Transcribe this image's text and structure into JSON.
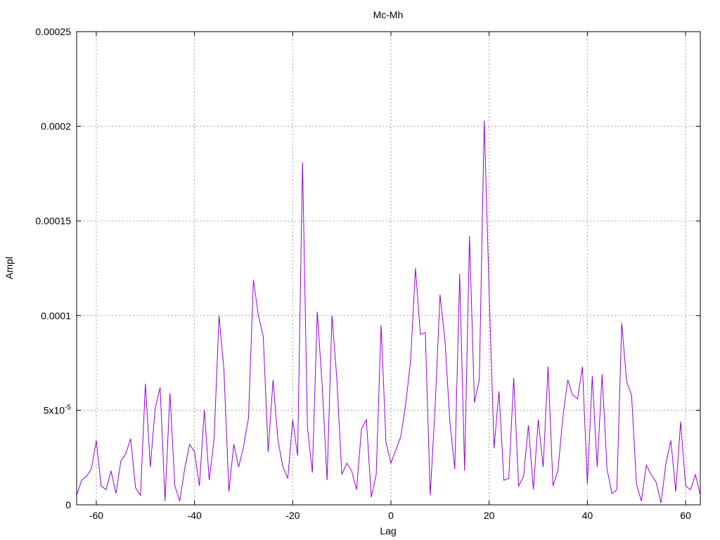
{
  "chart_data": {
    "type": "line",
    "title": "Mc-Mh",
    "xlabel": "Lag",
    "ylabel": "Ampl",
    "xlim": [
      -64,
      63
    ],
    "ylim": [
      0,
      0.00025
    ],
    "grid": true,
    "x_ticks": [
      {
        "value": -60,
        "label": "-60"
      },
      {
        "value": -40,
        "label": "-40"
      },
      {
        "value": -20,
        "label": "-20"
      },
      {
        "value": 0,
        "label": "0"
      },
      {
        "value": 20,
        "label": "20"
      },
      {
        "value": 40,
        "label": "40"
      },
      {
        "value": 60,
        "label": "60"
      }
    ],
    "y_ticks": [
      {
        "value": 0,
        "label": "0"
      },
      {
        "value": 5e-05,
        "label": "5x10",
        "exp": "-5"
      },
      {
        "value": 0.0001,
        "label": "0.0001"
      },
      {
        "value": 0.00015,
        "label": "0.00015"
      },
      {
        "value": 0.0002,
        "label": "0.0002"
      },
      {
        "value": 0.00025,
        "label": "0.00025"
      }
    ],
    "series": [
      {
        "color": "#9400d3",
        "x": [
          -64,
          -63,
          -62,
          -61,
          -60,
          -59,
          -58,
          -57,
          -56,
          -55,
          -54,
          -53,
          -52,
          -51,
          -50,
          -49,
          -48,
          -47,
          -46,
          -45,
          -44,
          -43,
          -42,
          -41,
          -40,
          -39,
          -38,
          -37,
          -36,
          -35,
          -34,
          -33,
          -32,
          -31,
          -30,
          -29,
          -28,
          -27,
          -26,
          -25,
          -24,
          -23,
          -22,
          -21,
          -20,
          -19,
          -18,
          -17,
          -16,
          -15,
          -14,
          -13,
          -12,
          -11,
          -10,
          -9,
          -8,
          -7,
          -6,
          -5,
          -4,
          -3,
          -2,
          -1,
          0,
          1,
          2,
          3,
          4,
          5,
          6,
          7,
          8,
          9,
          10,
          11,
          12,
          13,
          14,
          15,
          16,
          17,
          18,
          19,
          20,
          21,
          22,
          23,
          24,
          25,
          26,
          27,
          28,
          29,
          30,
          31,
          32,
          33,
          34,
          35,
          36,
          37,
          38,
          39,
          40,
          41,
          42,
          43,
          44,
          45,
          46,
          47,
          48,
          49,
          50,
          51,
          52,
          53,
          54,
          55,
          56,
          57,
          58,
          59,
          60,
          61,
          62,
          63
        ],
        "y": [
          5e-06,
          1.3e-05,
          1.5e-05,
          1.9e-05,
          3.4e-05,
          1e-05,
          8e-06,
          1.8e-05,
          6e-06,
          2.3e-05,
          2.7e-05,
          3.5e-05,
          9e-06,
          5e-06,
          6.4e-05,
          2e-05,
          5.1e-05,
          6.2e-05,
          2e-06,
          5.9e-05,
          1e-05,
          2e-06,
          1.9e-05,
          3.2e-05,
          2.8e-05,
          1e-05,
          5e-05,
          1.3e-05,
          3.5e-05,
          0.0001,
          7.1e-05,
          7e-06,
          3.2e-05,
          2e-05,
          3.1e-05,
          4.6e-05,
          0.000119,
          0.0001,
          8.9e-05,
          2.8e-05,
          6.6e-05,
          3.4e-05,
          2e-05,
          1.4e-05,
          4.5e-05,
          2.6e-05,
          0.000181,
          4.1e-05,
          1.7e-05,
          0.000102,
          6.3e-05,
          1.3e-05,
          0.0001,
          6.6e-05,
          1.6e-05,
          2.2e-05,
          1.8e-05,
          8e-06,
          4e-05,
          4.5e-05,
          4e-06,
          1.6e-05,
          9.5e-05,
          3.3e-05,
          2.2e-05,
          2.9e-05,
          3.6e-05,
          5.3e-05,
          7.6e-05,
          0.000125,
          9e-05,
          9.1e-05,
          5e-06,
          5.2e-05,
          0.000111,
          8.7e-05,
          4.4e-05,
          1.9e-05,
          0.000122,
          1.8e-05,
          0.000142,
          5.4e-05,
          6.6e-05,
          0.000203,
          0.000112,
          3e-05,
          6e-05,
          1.3e-05,
          1.4e-05,
          6.7e-05,
          1e-05,
          1.5e-05,
          4.2e-05,
          8e-06,
          4.5e-05,
          2e-05,
          7.3e-05,
          1e-05,
          1.8e-05,
          4.6e-05,
          6.6e-05,
          5.8e-05,
          5.6e-05,
          7.3e-05,
          1.1e-05,
          6.8e-05,
          2e-05,
          6.9e-05,
          1.9e-05,
          6e-06,
          8e-06,
          9.6e-05,
          6.5e-05,
          5.8e-05,
          1.1e-05,
          2e-06,
          2.1e-05,
          1.6e-05,
          1.2e-05,
          1e-06,
          2.2e-05,
          3.4e-05,
          7e-06,
          4.4e-05,
          1e-05,
          8e-06,
          1.6e-05,
          5e-06
        ]
      }
    ]
  }
}
